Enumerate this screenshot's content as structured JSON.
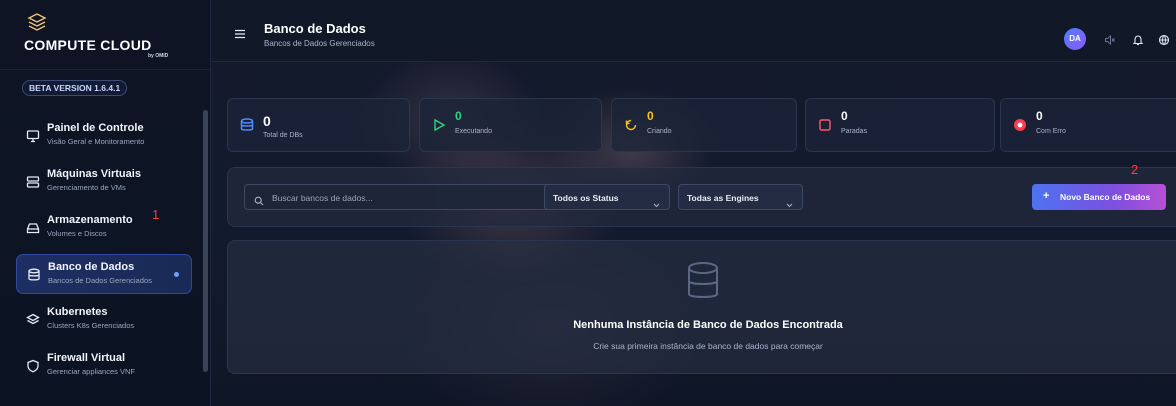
{
  "sidebar": {
    "brand_name": "COMPUTE CLOUD",
    "brand_sub": "by OMID",
    "beta": "BETA VERSION 1.6.4.1",
    "items": [
      {
        "label": "Painel de Controle",
        "sub": "Visão Geral e Monitoramento",
        "icon": "monitor-icon",
        "active": false
      },
      {
        "label": "Máquinas Virtuais",
        "sub": "Gerenciamento de VMs",
        "icon": "server-icon",
        "active": false
      },
      {
        "label": "Armazenamento",
        "sub": "Volumes e Discos",
        "icon": "drive-icon",
        "active": false
      },
      {
        "label": "Banco de Dados",
        "sub": "Bancos de Dados Gerenciados",
        "icon": "database-icon",
        "active": true
      },
      {
        "label": "Kubernetes",
        "sub": "Clusters K8s Gerenciados",
        "icon": "layers-icon",
        "active": false
      },
      {
        "label": "Firewall Virtual",
        "sub": "Gerenciar appliances VNF",
        "icon": "shield-icon",
        "active": false
      }
    ],
    "annotation": "1"
  },
  "header": {
    "title": "Banco de Dados",
    "subtitle": "Bancos de Dados Gerenciados",
    "avatar": "DA"
  },
  "stats": [
    {
      "value": "0",
      "label": "Total de DBs",
      "icon": "database-icon",
      "color": "#4f8dff"
    },
    {
      "value": "0",
      "label": "Executando",
      "icon": "play-icon",
      "color": "#2bd67b"
    },
    {
      "value": "0",
      "label": "Criando",
      "icon": "refresh-icon",
      "color": "#f5c518"
    },
    {
      "value": "0",
      "label": "Paradas",
      "icon": "square-icon",
      "color": "#ff5a6a"
    },
    {
      "value": "0",
      "label": "Com Erro",
      "icon": "record-icon",
      "color": "#ff3b4e"
    }
  ],
  "filters": {
    "search_placeholder": "Buscar bancos de dados...",
    "status": "Todos os Status",
    "engines": "Todas as Engines",
    "new_button": "Novo Banco de Dados",
    "new_plus": "+",
    "annotation": "2"
  },
  "empty": {
    "title": "Nenhuma Instância de Banco de Dados Encontrada",
    "subtitle": "Crie sua primeira instância de banco de dados para começar"
  },
  "colors": {
    "accent": "#4d73f0",
    "active_nav": "#1d2f63",
    "annotation": "#ff3b3b"
  }
}
